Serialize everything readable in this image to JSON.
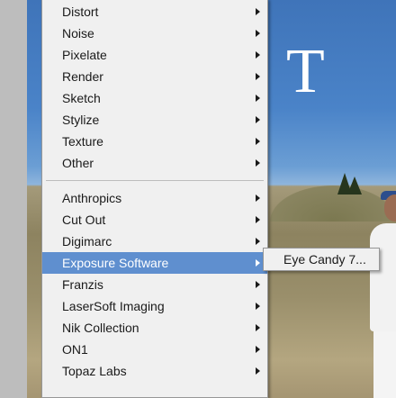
{
  "background": {
    "photo_text": "T",
    "colors": {
      "sky": "#4a83c8",
      "ground": "#9a8f6b"
    }
  },
  "filter_menu": {
    "group_builtin": [
      {
        "label": "Distort",
        "has_submenu": true
      },
      {
        "label": "Noise",
        "has_submenu": true
      },
      {
        "label": "Pixelate",
        "has_submenu": true
      },
      {
        "label": "Render",
        "has_submenu": true
      },
      {
        "label": "Sketch",
        "has_submenu": true
      },
      {
        "label": "Stylize",
        "has_submenu": true
      },
      {
        "label": "Texture",
        "has_submenu": true
      },
      {
        "label": "Other",
        "has_submenu": true
      }
    ],
    "group_plugins": [
      {
        "label": "Anthropics",
        "has_submenu": true
      },
      {
        "label": "Cut Out",
        "has_submenu": true
      },
      {
        "label": "Digimarc",
        "has_submenu": true
      },
      {
        "label": "Exposure Software",
        "has_submenu": true,
        "selected": true
      },
      {
        "label": "Franzis",
        "has_submenu": true
      },
      {
        "label": "LaserSoft Imaging",
        "has_submenu": true
      },
      {
        "label": "Nik Collection",
        "has_submenu": true
      },
      {
        "label": "ON1",
        "has_submenu": true
      },
      {
        "label": "Topaz Labs",
        "has_submenu": true
      }
    ],
    "highlight_color": "#5f8fcf"
  },
  "submenu": {
    "items": [
      {
        "label": "Eye Candy 7..."
      }
    ]
  }
}
